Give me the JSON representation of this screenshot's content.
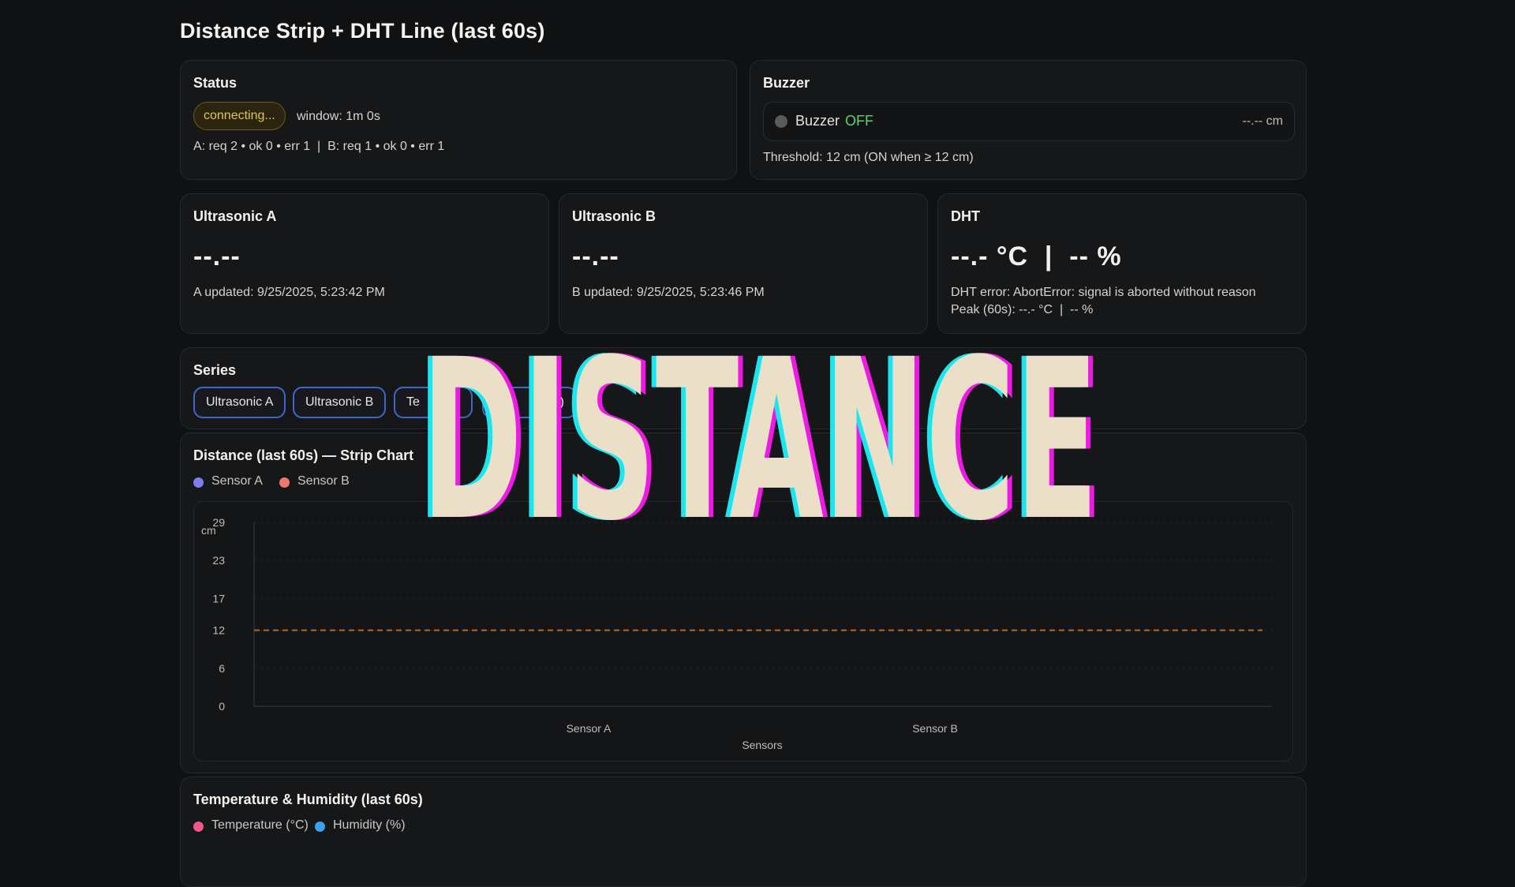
{
  "page": {
    "title": "Distance Strip + DHT Line (last 60s)"
  },
  "status": {
    "title": "Status",
    "pill": "connecting...",
    "window": "window: 1m 0s",
    "counters": "A: req 2 • ok 0 • err 1  |  B: req 1 • ok 0 • err 1"
  },
  "buzzer": {
    "title": "Buzzer",
    "label": "Buzzer",
    "state": "OFF",
    "distance": "--.-- cm",
    "threshold": "Threshold: 12 cm (ON when ≥ 12 cm)",
    "colors": {
      "indicator": "#5a5a5a",
      "state_off": "#5fd36b"
    }
  },
  "sensor_a": {
    "title": "Ultrasonic A",
    "value": "--.--",
    "updated": "A updated: 9/25/2025, 5:23:42 PM"
  },
  "sensor_b": {
    "title": "Ultrasonic B",
    "value": "--.--",
    "updated": "B updated: 9/25/2025, 5:23:46 PM"
  },
  "dht": {
    "title": "DHT",
    "value": "--.- °C  |  -- %",
    "error": "DHT error: AbortError: signal is aborted without reason",
    "peak": "Peak (60s): --.- °C  |  -- %"
  },
  "series": {
    "title": "Series",
    "chips": [
      "Ultrasonic A",
      "Ultrasonic B",
      "Te",
      "%)"
    ]
  },
  "distance_chart": {
    "title": "Distance (last 60s) — Strip Chart",
    "legend": [
      {
        "label": "Sensor A",
        "color": "#7b7ff0"
      },
      {
        "label": "Sensor B",
        "color": "#f0766e"
      }
    ]
  },
  "chart_data": {
    "type": "line",
    "title": "Distance (last 60s) — Strip Chart",
    "xlabel": "Sensors",
    "ylabel": "cm",
    "categories": [
      "Sensor A",
      "Sensor B"
    ],
    "yticks": [
      0,
      6,
      12,
      17,
      23,
      29
    ],
    "ylim": [
      0,
      29
    ],
    "threshold": 12,
    "threshold_color": "#b06a2a",
    "series": [
      {
        "name": "Sensor A",
        "values": []
      },
      {
        "name": "Sensor B",
        "values": []
      }
    ],
    "grid": true
  },
  "th_chart": {
    "title": "Temperature & Humidity (last 60s)",
    "legend": [
      {
        "label": "Temperature (°C)",
        "color": "#f0588a"
      },
      {
        "label": "Humidity (%)",
        "color": "#3aa2f0"
      }
    ]
  },
  "overlay": {
    "text": "DISTANCE",
    "fill": "#ebdfc8",
    "cyan": "#19e6ef",
    "magenta": "#ef19e6"
  }
}
